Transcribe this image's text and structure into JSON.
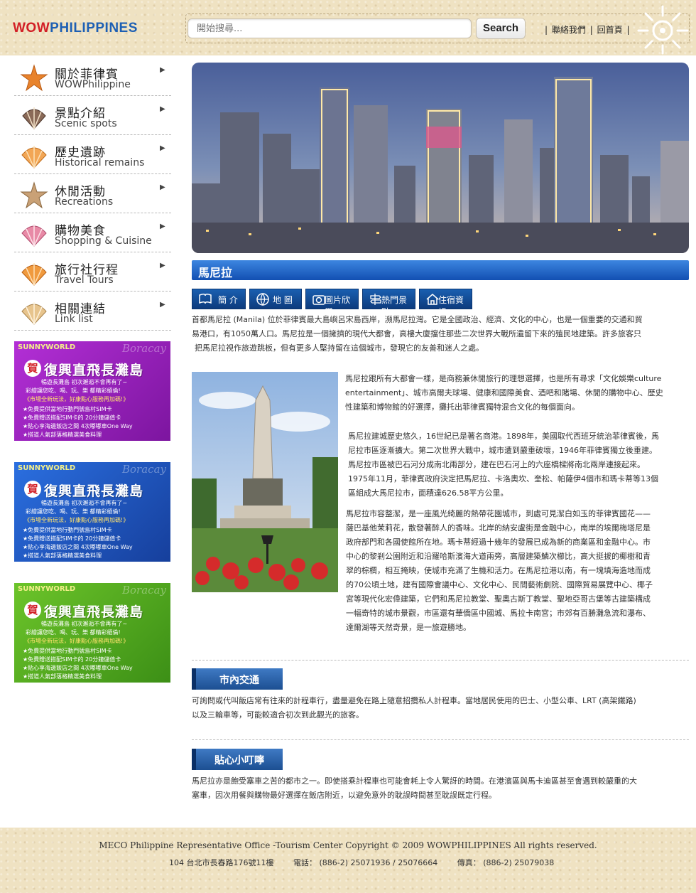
{
  "header": {
    "logo_wow": "WOW",
    "logo_rest": "PHILIPPINES",
    "search_placeholder": "開始搜尋...",
    "search_button": "Search",
    "link_contact": "聯絡我們",
    "link_home": "回首頁",
    "separator": "|"
  },
  "sidebar": {
    "items": [
      {
        "cn": "關於菲律賓",
        "en": "WOWPhilippine",
        "icon": "starfish-icon"
      },
      {
        "cn": "景點介紹",
        "en": "Scenic spots",
        "icon": "seashell-icon"
      },
      {
        "cn": "歷史遺跡",
        "en": "Historical remains",
        "icon": "seashell-icon"
      },
      {
        "cn": "休閒活動",
        "en": "Recreations",
        "icon": "starfish-icon"
      },
      {
        "cn": "購物美食",
        "en": "Shopping & Cuisine",
        "icon": "seashell-icon"
      },
      {
        "cn": "旅行社行程",
        "en": "Travel Tours",
        "icon": "seashell-icon"
      },
      {
        "cn": "相關連結",
        "en": "Link list",
        "icon": "seashell-icon"
      }
    ],
    "arrow": "▶",
    "ads": [
      {
        "color": "#9a24c4",
        "brand": "SUNNYWORLD",
        "script": "Boracay",
        "he": "賀",
        "headline": "復興直飛長灘島",
        "line1": "暢遊長灘島  初次邂逅不會再有了~",
        "line2": "彩繪讓您吃、喝、玩、樂 都精彩絕倫!",
        "line3": "《市場全新玩法，好康點心服務再加碼!》",
        "bullets": [
          "★免費提供當地行動門號島村SIM卡",
          "★免費贈送搭配SIM卡的 20分鐘儲值卡",
          "★貼心享海邊飯店之間 4次嘟嘟車One Way",
          "★搭道人氣部落格精選美食料理"
        ]
      },
      {
        "color": "#1f56c0",
        "brand": "SUNNYWORLD",
        "script": "Boracay",
        "he": "賀",
        "headline": "復興直飛長灘島",
        "line1": "暢遊長灘島  初次邂逅不會再有了~",
        "line2": "彩繪讓您吃、喝、玩、樂 都精彩絕倫!",
        "line3": "《市場全新玩法，好康點心服務再加碼!》",
        "bullets": [
          "★免費提供當地行動門號島村SIM卡",
          "★免費贈送搭配SIM卡的 20分鐘儲值卡",
          "★貼心享海邊飯店之間 4次嘟嘟車One Way",
          "★搭道人氣部落格精選美食料理"
        ]
      },
      {
        "color": "#5cae22",
        "brand": "SUNNYWORLD",
        "script": "Boracay",
        "he": "賀",
        "headline": "復興直飛長灘島",
        "line1": "暢遊長灘島  初次邂逅不會再有了~",
        "line2": "彩繪讓您吃、喝、玩、樂 都精彩絕倫!",
        "line3": "《市場全新玩法，好康點心服務再加碼!》",
        "bullets": [
          "★免費提供當地行動門號島村SIM卡",
          "★免費贈送搭配SIM卡的 20分鐘儲值卡",
          "★貼心享海邊飯店之間 4次嘟嘟車One Way",
          "★搭道人氣部落格精選美食料理"
        ]
      }
    ]
  },
  "main": {
    "title": "馬尼拉",
    "tabs": [
      {
        "label": "簡 介",
        "icon": "book-icon"
      },
      {
        "label": "地 圖",
        "icon": "globe-icon"
      },
      {
        "label": "圖片欣賞",
        "icon": "camera-icon"
      },
      {
        "label": "熱門景點",
        "icon": "signpost-icon"
      },
      {
        "label": "住宿資訊",
        "icon": "house-icon"
      }
    ],
    "intro": [
      "首都馬尼拉 (Manila) 位於菲律賓最大島嶼呂宋島西岸，瀕馬尼拉灣。它是全國政治、經濟、文化的中心，也是一個重要的交通和貿",
      "易港口，有1050萬人口。馬尼拉是一個擁擠的現代大都會，高樓大廈擋住那些二次世界大戰所遺留下來的殖民地建築。許多旅客只",
      "把馬尼拉視作旅遊跳板，但有更多人堅持留在這個城市，發現它的友善和迷人之處。"
    ],
    "p1": [
      "馬尼拉跟所有大都會一樣，是商務兼休閒旅行的理想選擇，也是所有尋求「文化娛樂culture",
      "entertainment」、城市高爾夫球場、健康和國際美食、酒吧和賭場、休閒的購物中心、歷史",
      "性建築和博物館的好選擇，攤托出菲律賓獨特混合文化的每個面向。"
    ],
    "p2": [
      "馬尼拉建城歷史悠久，16世紀已是著名商港。1898年，美國取代西班牙統治菲律賓後，馬",
      "尼拉市區逐漸擴大。第二次世界大戰中，城市遭到嚴重破壞，1946年菲律賓獨立後重建。",
      "馬尼拉市區被巴石河分成南北兩部分，建在巴石河上的六座橋樑將南北兩岸連接起來。",
      "1975年11月，菲律賓政府決定把馬尼拉、卡洛奧坎、奎松、帕薩伊4個市和瑪卡蒂等13個",
      "區組成大馬尼拉市，面積達626.58平方公里。"
    ],
    "p3": [
      "馬尼拉市容整潔，是一座風光綺麗的熱帶花園城市，到處可見潔白如玉的菲律賓國花——",
      "薩巴基他茉莉花，散發著醉人的香味。北岸的納安盧街是金融中心，南岸的埃爾梅塔尼是",
      "政府部門和各國使館所在地。瑪卡蒂經過十幾年的發展已成為新的商業區和金融中心。市",
      "中心的黎剎公園附近和沿羅哈斯濱海大道兩旁，高層建築鱗次櫛比，高大挺拔的椰樹和青",
      "翠的棕櫚，相互掩映，使城市充滿了生機和活力。在馬尼拉港以南，有一塊填海造地而成",
      "的70公頃土地，建有國際會議中心、文化中心、民間藝術劇院、國際貿易展覽中心、椰子",
      "宮等現代化宏偉建築，它們和馬尼拉教堂、聖奧古斯丁教堂、聖地亞哥古堡等古建築構成",
      "一幅奇特的城市景觀，市區還有華僑區中國城、馬拉卡南宮；市郊有百勝灘急流和瀑布、",
      "達爾湖等天然奇景，是一旅遊勝地。"
    ],
    "transport_title": "市內交通",
    "transport": [
      "可詢問或代叫飯店常有往來的計程車行，盡量避免在路上隨意招攬私人計程車。當地居民使用的巴士、小型公車、LRT (高架鐵路)",
      "以及三輪車等，可能較適合初次到此觀光的旅客。"
    ],
    "tips_title": "貼心小叮嚀",
    "tips": [
      "馬尼拉亦是飽受塞車之苦的都市之一。即使搭乘計程車也可能會耗上令人驚訝的時間。在港濱區與馬卡迪區甚至會遇到較嚴重的大",
      "塞車，因次用餐與購物最好選擇在飯店附近，以避免意外的耽誤時間甚至耽誤既定行程。"
    ]
  },
  "footer": {
    "line1": "MECO Philippine Representative Office -Tourism Center     Copyright © 2009 WOWPHILIPPINES All rights reserved.",
    "address": "104 台北市長春路176號11樓",
    "phone": "電話：  (886-2) 25071936 / 25076664",
    "fax": "傳真：  (886-2) 25079038"
  }
}
